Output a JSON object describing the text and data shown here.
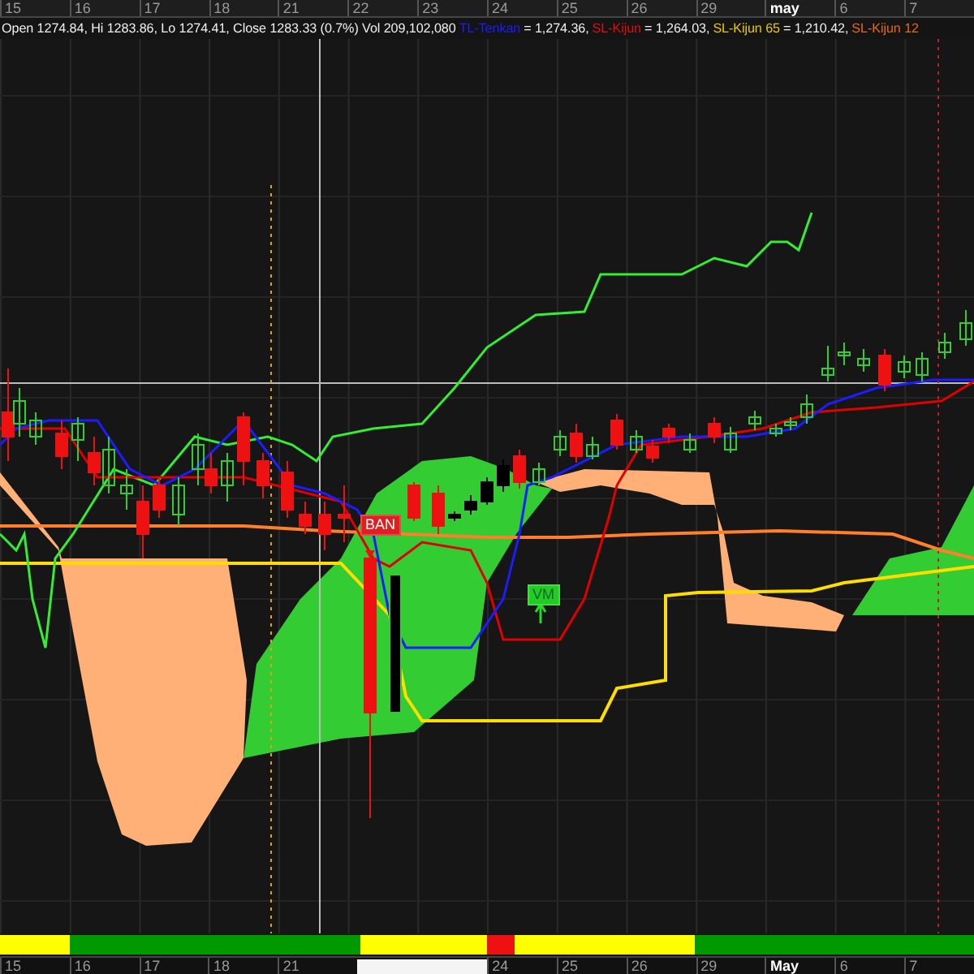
{
  "top_axis": {
    "labels": [
      {
        "text": "15",
        "kind": "day"
      },
      {
        "text": "16",
        "kind": "day"
      },
      {
        "text": "17",
        "kind": "day"
      },
      {
        "text": "18",
        "kind": "day"
      },
      {
        "text": "21",
        "kind": "day"
      },
      {
        "text": "22",
        "kind": "day"
      },
      {
        "text": "23",
        "kind": "day"
      },
      {
        "text": "24",
        "kind": "day"
      },
      {
        "text": "25",
        "kind": "day"
      },
      {
        "text": "26",
        "kind": "day"
      },
      {
        "text": "29",
        "kind": "day"
      },
      {
        "text": "may",
        "kind": "month"
      },
      {
        "text": "6",
        "kind": "day"
      },
      {
        "text": "7",
        "kind": "day"
      }
    ]
  },
  "legend": {
    "ohlc": "Open 1274.84, Hi 1283.86, Lo 1274.41, Close 1283.33 (0.7%) Vol 209,102,080",
    "indicators": [
      {
        "name": "TL-Tenkan",
        "color": "#1c1cff",
        "value": "= 1,274.36,"
      },
      {
        "name": "SL-Kijun",
        "color": "#e01010",
        "value": "= 1,264.03,"
      },
      {
        "name": "SL-Kijun 65",
        "color": "#e8c800",
        "value": "= 1,210.42,"
      },
      {
        "name": "SL-Kijun 12",
        "color": "#e86a10"
      }
    ]
  },
  "chart": {
    "tags": [
      {
        "text": "BAN",
        "kind": "sell"
      },
      {
        "text": "VM",
        "kind": "buy"
      }
    ]
  },
  "bottom_axis": {
    "labels": [
      {
        "text": "15",
        "kind": "day"
      },
      {
        "text": "16",
        "kind": "day"
      },
      {
        "text": "17",
        "kind": "day"
      },
      {
        "text": "18",
        "kind": "day"
      },
      {
        "text": "21",
        "kind": "day"
      },
      {
        "kind": "tooltip"
      },
      {
        "text": "24",
        "kind": "day"
      },
      {
        "text": "25",
        "kind": "day"
      },
      {
        "text": "26",
        "kind": "day"
      },
      {
        "text": "29",
        "kind": "day"
      },
      {
        "text": "May",
        "kind": "month"
      },
      {
        "text": "6",
        "kind": "day"
      },
      {
        "text": "7",
        "kind": "day"
      }
    ]
  }
}
